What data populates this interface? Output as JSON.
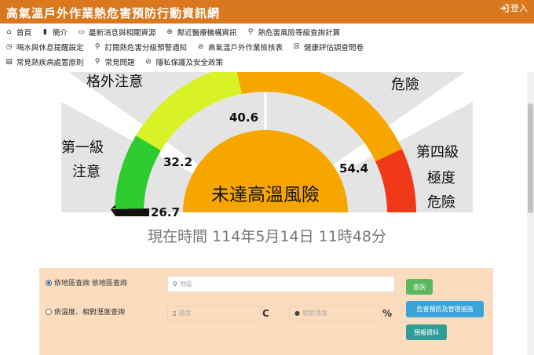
{
  "header": {
    "title": "高氣溫戶外作業熱危害預防行動資訊網",
    "login_label": "登入"
  },
  "nav": {
    "row1": [
      {
        "label": "首頁",
        "icon": "home-icon"
      },
      {
        "label": "簡介",
        "icon": "bookmark-icon"
      },
      {
        "label": "最新消息與相關資源",
        "icon": "folder-icon"
      },
      {
        "label": "鄰近醫療機構資訊",
        "icon": "plus-circle-icon"
      },
      {
        "label": "熱危害風險等級查詢計算",
        "icon": "map-pin-icon"
      }
    ],
    "row2": [
      {
        "label": "喝水與休息提醒設定",
        "icon": "clock-icon"
      },
      {
        "label": "訂閱熱危害分級預警通知",
        "icon": "map-pin-icon"
      },
      {
        "label": "高氣溫戶外作業檢核表",
        "icon": "check-circle-icon"
      },
      {
        "label": "健康評估調查問卷",
        "icon": "checkbox-icon"
      }
    ],
    "row3": [
      {
        "label": "常見熱疾病處置原則",
        "icon": "clipboard-icon"
      },
      {
        "label": "常見問題",
        "icon": "map-pin-icon"
      },
      {
        "label": "隱私保護及安全政策",
        "icon": "check-circle-icon"
      }
    ]
  },
  "gauge": {
    "center_text": "未達高溫風險",
    "current_value": 26.7,
    "thresholds": [
      {
        "value": "26.7"
      },
      {
        "value": "32.2"
      },
      {
        "value": "40.6"
      },
      {
        "value": "54.4"
      }
    ],
    "zone_labels": {
      "level1_line1": "第一級",
      "level1_line2": "注意",
      "level2_partial": "格外注意",
      "level3_partial": "危險",
      "level4_line1": "第四級",
      "level4_line2": "極度",
      "level4_line3": "危險"
    },
    "colors": {
      "green": "#2ecc2e",
      "yellow": "#d9f227",
      "orange": "#f7a600",
      "red": "#f03a17",
      "gray": "#e4e4e4",
      "needle": "#111111"
    }
  },
  "now_time": "現在時間 114年5月14日 11時48分",
  "query": {
    "option_location": "依地區查詢 依地區查詢",
    "option_temp": "依溫度、相對溼度查詢",
    "location_placeholder": "地區",
    "temp_placeholder": "溫度",
    "temp_unit": "C",
    "humidity_placeholder": "相對溼度",
    "humidity_unit": "%",
    "query_button": "查詢",
    "prevention_button": "危害預防及管理措施",
    "forecast_button": "預報資料"
  },
  "accent_color": "#d9781f",
  "panel_color": "#fbdcbf"
}
